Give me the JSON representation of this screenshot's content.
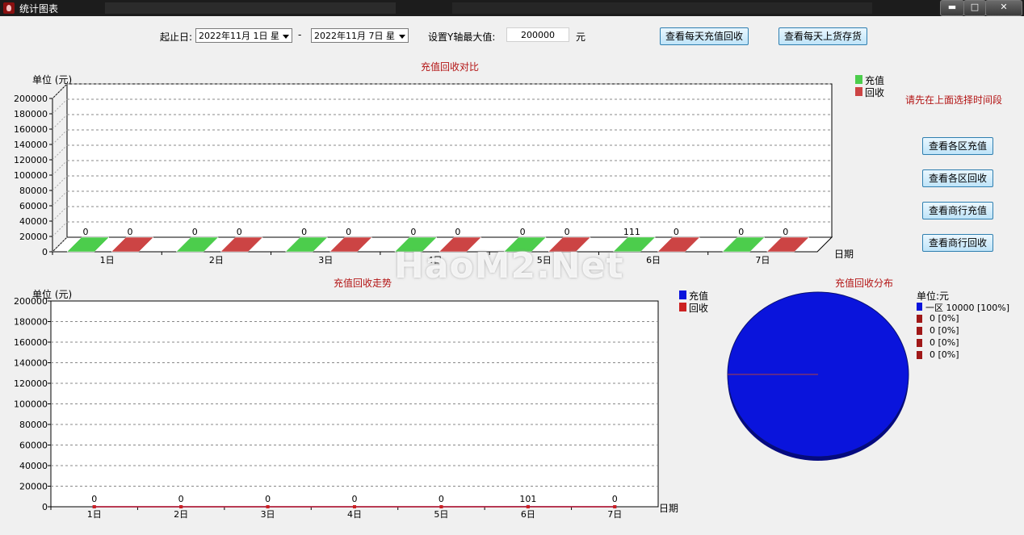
{
  "window": {
    "title": "统计图表",
    "minimize_glyph": "▬",
    "maximize_glyph": "□",
    "close_glyph": "✕"
  },
  "toolbar": {
    "start_label": "起止日:",
    "start_date": "2022年11月 1日 星",
    "dash": "-",
    "end_date": "2022年11月 7日 星",
    "ymax_label": "设置Y轴最大值:",
    "ymax_value": "200000",
    "ymax_unit": "元",
    "daily_recharge_btn": "查看每天充值回收",
    "daily_stock_btn": "查看每天上货存货"
  },
  "side": {
    "hint": "请先在上面选择时间段",
    "btn_zone_recharge": "查看各区充值",
    "btn_zone_recycle": "查看各区回收",
    "btn_merchant_recharge": "查看商行充值",
    "btn_merchant_recycle": "查看商行回收"
  },
  "colors": {
    "recharge": "#4ccd4c",
    "recycle": "#cc4444",
    "pie_blue": "#0a14dc",
    "title_red": "#b31414"
  },
  "watermark": "HaoM2.Net",
  "chart_data": [
    {
      "type": "bar",
      "title": "充值回收对比",
      "ylabel": "单位 (元)",
      "xlabel": "日期",
      "ylim": [
        0,
        200000
      ],
      "yticks": [
        0,
        20000,
        40000,
        60000,
        80000,
        100000,
        120000,
        140000,
        160000,
        180000,
        200000
      ],
      "categories": [
        "1日",
        "2日",
        "3日",
        "4日",
        "5日",
        "6日",
        "7日"
      ],
      "series": [
        {
          "name": "充值",
          "values": [
            0,
            0,
            0,
            0,
            0,
            111,
            0
          ],
          "labels": [
            "0",
            "0",
            "0",
            "0",
            "0",
            "111",
            "0"
          ]
        },
        {
          "name": "回收",
          "values": [
            0,
            0,
            0,
            0,
            0,
            0,
            0
          ],
          "labels": [
            "0",
            "0",
            "0",
            "0",
            "0",
            "0",
            "0"
          ]
        }
      ],
      "legend": "top-right",
      "grid": true
    },
    {
      "type": "line",
      "title": "充值回收走势",
      "ylabel": "单位 (元)",
      "xlabel": "日期",
      "ylim": [
        0,
        200000
      ],
      "yticks": [
        0,
        20000,
        40000,
        60000,
        80000,
        100000,
        120000,
        140000,
        160000,
        180000,
        200000
      ],
      "categories": [
        "1日",
        "2日",
        "3日",
        "4日",
        "5日",
        "6日",
        "7日"
      ],
      "series": [
        {
          "name": "充值",
          "values": [
            0,
            0,
            0,
            0,
            0,
            111,
            0
          ]
        },
        {
          "name": "回收",
          "values": [
            0,
            0,
            0,
            0,
            0,
            0,
            0
          ]
        }
      ],
      "point_labels": [
        "0",
        "0",
        "0",
        "0",
        "0",
        "101",
        "0"
      ],
      "legend": "top-right",
      "grid": true
    },
    {
      "type": "pie",
      "title": "充值回收分布",
      "unit_label": "单位:元",
      "slices": [
        {
          "name": "一区",
          "value": 10000,
          "label": "一区  10000 [100%]",
          "color": "#0a14dc"
        },
        {
          "name": "",
          "value": 0,
          "label": "0 [0%]",
          "color": "#a01818"
        },
        {
          "name": "",
          "value": 0,
          "label": "0 [0%]",
          "color": "#a01818"
        },
        {
          "name": "",
          "value": 0,
          "label": "0 [0%]",
          "color": "#a01818"
        },
        {
          "name": "",
          "value": 0,
          "label": "0 [0%]",
          "color": "#a01818"
        }
      ]
    }
  ]
}
